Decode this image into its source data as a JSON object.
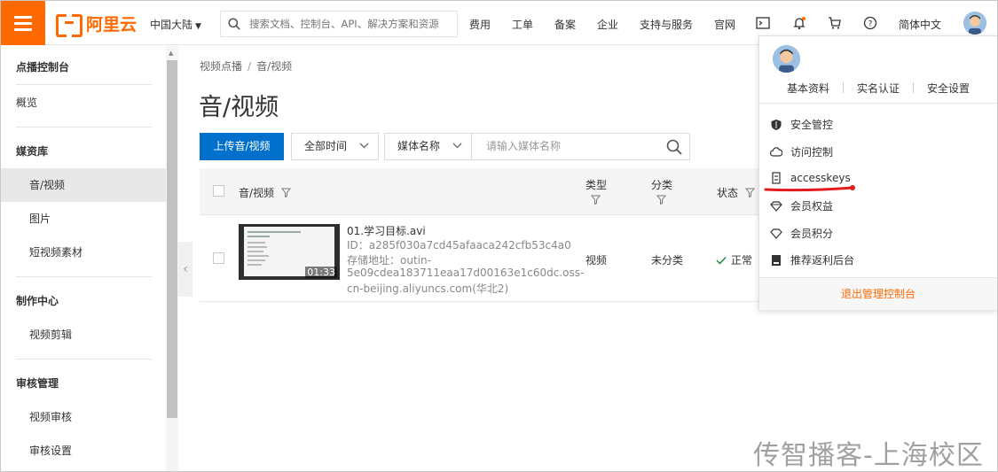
{
  "header": {
    "logo_text": "阿里云",
    "region": "中国大陆",
    "search_placeholder": "搜索文档、控制台、API、解决方案和资源",
    "nav": [
      "费用",
      "工单",
      "备案",
      "企业",
      "支持与服务",
      "官网"
    ],
    "language": "简体中文",
    "brand_color": "#ff6a00"
  },
  "sidebar": {
    "title": "点播控制台",
    "overview": "概览",
    "groups": [
      {
        "label": "媒资库",
        "items": [
          "音/视频",
          "图片",
          "短视频素材"
        ]
      },
      {
        "label": "制作中心",
        "items": [
          "视频剪辑"
        ]
      },
      {
        "label": "审核管理",
        "items": [
          "视频审核",
          "审核设置"
        ]
      }
    ],
    "active_item": "音/视频"
  },
  "main": {
    "breadcrumb": [
      "视频点播",
      "音/视频"
    ],
    "title": "音/视频",
    "upload_button": "上传音/视频",
    "time_filter": "全部时间",
    "name_filter": "媒体名称",
    "search_placeholder": "请输入媒体名称",
    "columns": {
      "media": "音/视频",
      "type": "类型",
      "category": "分类",
      "status": "状态"
    },
    "rows": [
      {
        "name": "01.学习目标.avi",
        "id": "ID：a285f030a7cd45afaaca242cfb53c4a0",
        "storage_1": "存储地址：outin-",
        "storage_2": "5e09cdea183711eaa17d00163e1c60dc.oss-",
        "storage_3": "cn-beijing.aliyuncs.com(华北2)",
        "duration": "01:33",
        "type": "视频",
        "category": "未分类",
        "status": "正常"
      }
    ],
    "accent_color": "#0070cc"
  },
  "account_menu": {
    "links": [
      "基本资料",
      "实名认证",
      "安全设置"
    ],
    "items": [
      {
        "label": "安全管控",
        "icon": "shield-icon"
      },
      {
        "label": "访问控制",
        "icon": "cloud-icon"
      },
      {
        "label": "accesskeys",
        "icon": "key-icon"
      },
      {
        "label": "会员权益",
        "icon": "diamond-icon"
      },
      {
        "label": "会员积分",
        "icon": "diamond-outline-icon"
      },
      {
        "label": "推荐返利后台",
        "icon": "bookmark-icon"
      }
    ],
    "logout": "退出管理控制台"
  },
  "watermark": "传智播客-上海校区"
}
